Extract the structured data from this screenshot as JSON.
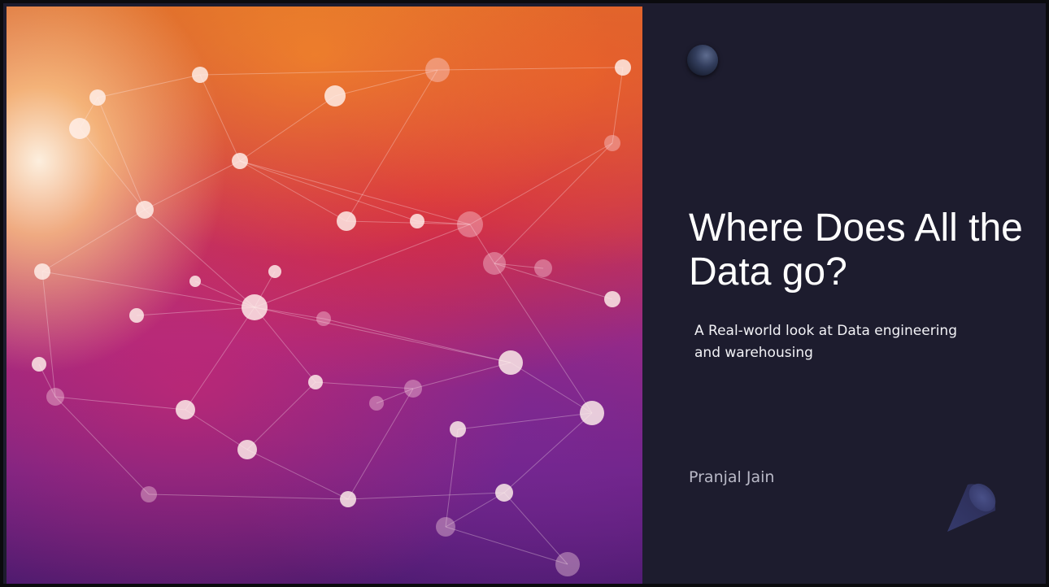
{
  "slide": {
    "title": "Where Does All the Data go?",
    "subtitle": "A Real-world look at Data engineering and warehousing",
    "author": "Pranjal Jain"
  },
  "decorations": {
    "background_image": "network-nodes-image",
    "top_icon": "dark-orb-icon",
    "bottom_icon": "cone-shape-icon"
  },
  "colors": {
    "panel_background": "#1d1c2e",
    "title": "#ffffff",
    "author": "#b9b9c7"
  }
}
